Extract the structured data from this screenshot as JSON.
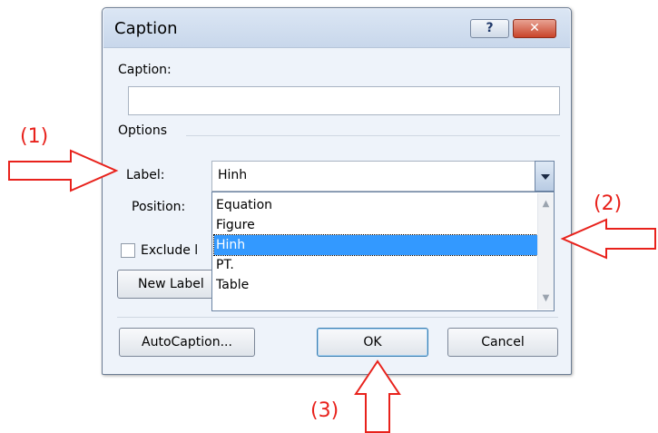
{
  "dialog": {
    "title": "Caption",
    "help_glyph": "?",
    "close_glyph": "✕",
    "caption_label": "Caption:",
    "caption_value": "",
    "options_label": "Options",
    "label_label": "Label:",
    "label_value": "Hinh",
    "position_label": "Position:",
    "exclude_label": "Exclude l",
    "new_label_button": "New Label",
    "dropdown_options": [
      "Equation",
      "Figure",
      "Hinh",
      "PT.",
      "Table"
    ],
    "selected_option": "Hinh",
    "autocaption_button": "AutoCaption...",
    "ok_button": "OK",
    "cancel_button": "Cancel"
  },
  "annotations": {
    "one": "(1)",
    "two": "(2)",
    "three": "(3)"
  },
  "colors": {
    "annotation": "#e8221c",
    "selection": "#3399ff"
  }
}
